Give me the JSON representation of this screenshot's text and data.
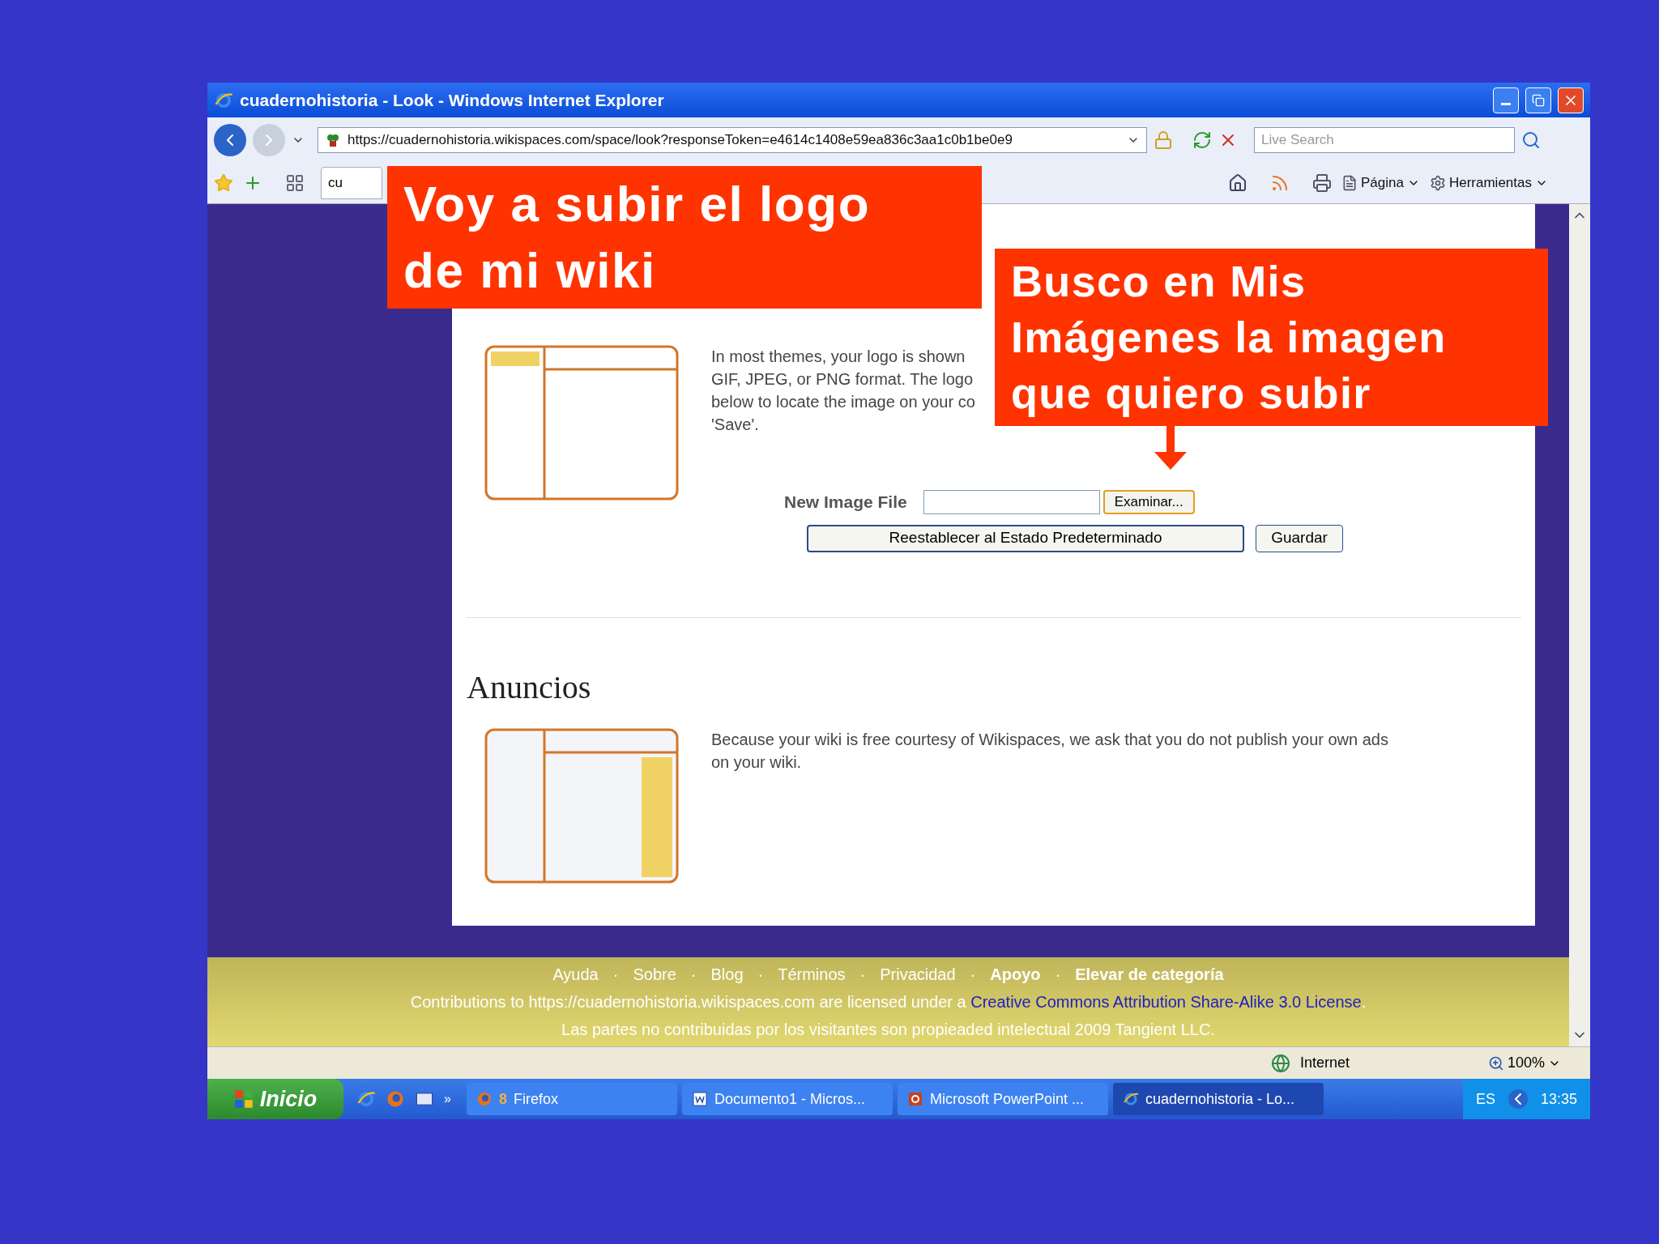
{
  "slide": {
    "callouts": [
      {
        "lines": [
          "Voy a subir el logo",
          "de mi wiki"
        ],
        "arrow": false
      },
      {
        "lines": [
          "Busco en Mis",
          "Imágenes la imagen",
          "que quiero subir"
        ],
        "arrow": true
      }
    ]
  },
  "window": {
    "title": "cuadernohistoria - Look - Windows Internet Explorer"
  },
  "address_bar": {
    "url": "https://cuadernohistoria.wikispaces.com/space/look?responseToken=e4614c1408e59ea836c3aa1c0b1be0e9",
    "search_placeholder": "Live Search"
  },
  "command_bar": {
    "tab": "cu",
    "menus": [
      "Página",
      "Herramientas"
    ]
  },
  "page": {
    "logo_section": {
      "description_lines": [
        "In most themes, your logo is shown",
        "GIF, JPEG, or PNG format. The logo",
        "below to locate the image on your co",
        "'Save'."
      ],
      "file_label": "New Image File",
      "browse_button": "Examinar...",
      "reset_button": "Reestablecer al Estado Predeterminado",
      "save_button": "Guardar"
    },
    "ads_section": {
      "heading": "Anuncios",
      "description": "Because your wiki is free courtesy of Wikispaces, we ask that you do not publish your own ads on your wiki."
    }
  },
  "footer": {
    "separator": "·",
    "links": [
      {
        "label": "Ayuda",
        "bold": false
      },
      {
        "label": "Sobre",
        "bold": false
      },
      {
        "label": "Blog",
        "bold": false
      },
      {
        "label": "Términos",
        "bold": false
      },
      {
        "label": "Privacidad",
        "bold": false
      },
      {
        "label": "Apoyo",
        "bold": true
      },
      {
        "label": "Elevar de categoría",
        "bold": true
      }
    ],
    "license_prefix": "Contributions to https://cuadernohistoria.wikispaces.com are licensed under a ",
    "license_link": "Creative Commons Attribution Share-Alike 3.0 License",
    "license_suffix": ".",
    "copyright": "Las partes no contribuidas por los visitantes son propieaded intelectual 2009 Tangient LLC."
  },
  "status_bar": {
    "zone": "Internet",
    "zoom": "100%"
  },
  "taskbar": {
    "start": "Inicio",
    "more": "»",
    "tasks": [
      {
        "kind": "firefox",
        "count": "8",
        "label": "Firefox",
        "selected": false
      },
      {
        "kind": "word",
        "label": "Documento1 - Micros...",
        "selected": false
      },
      {
        "kind": "powerpoint",
        "label": "Microsoft PowerPoint ...",
        "selected": false
      },
      {
        "kind": "ie",
        "label": "cuadernohistoria - Lo...",
        "selected": true
      }
    ],
    "language": "ES",
    "clock": "13:35"
  }
}
